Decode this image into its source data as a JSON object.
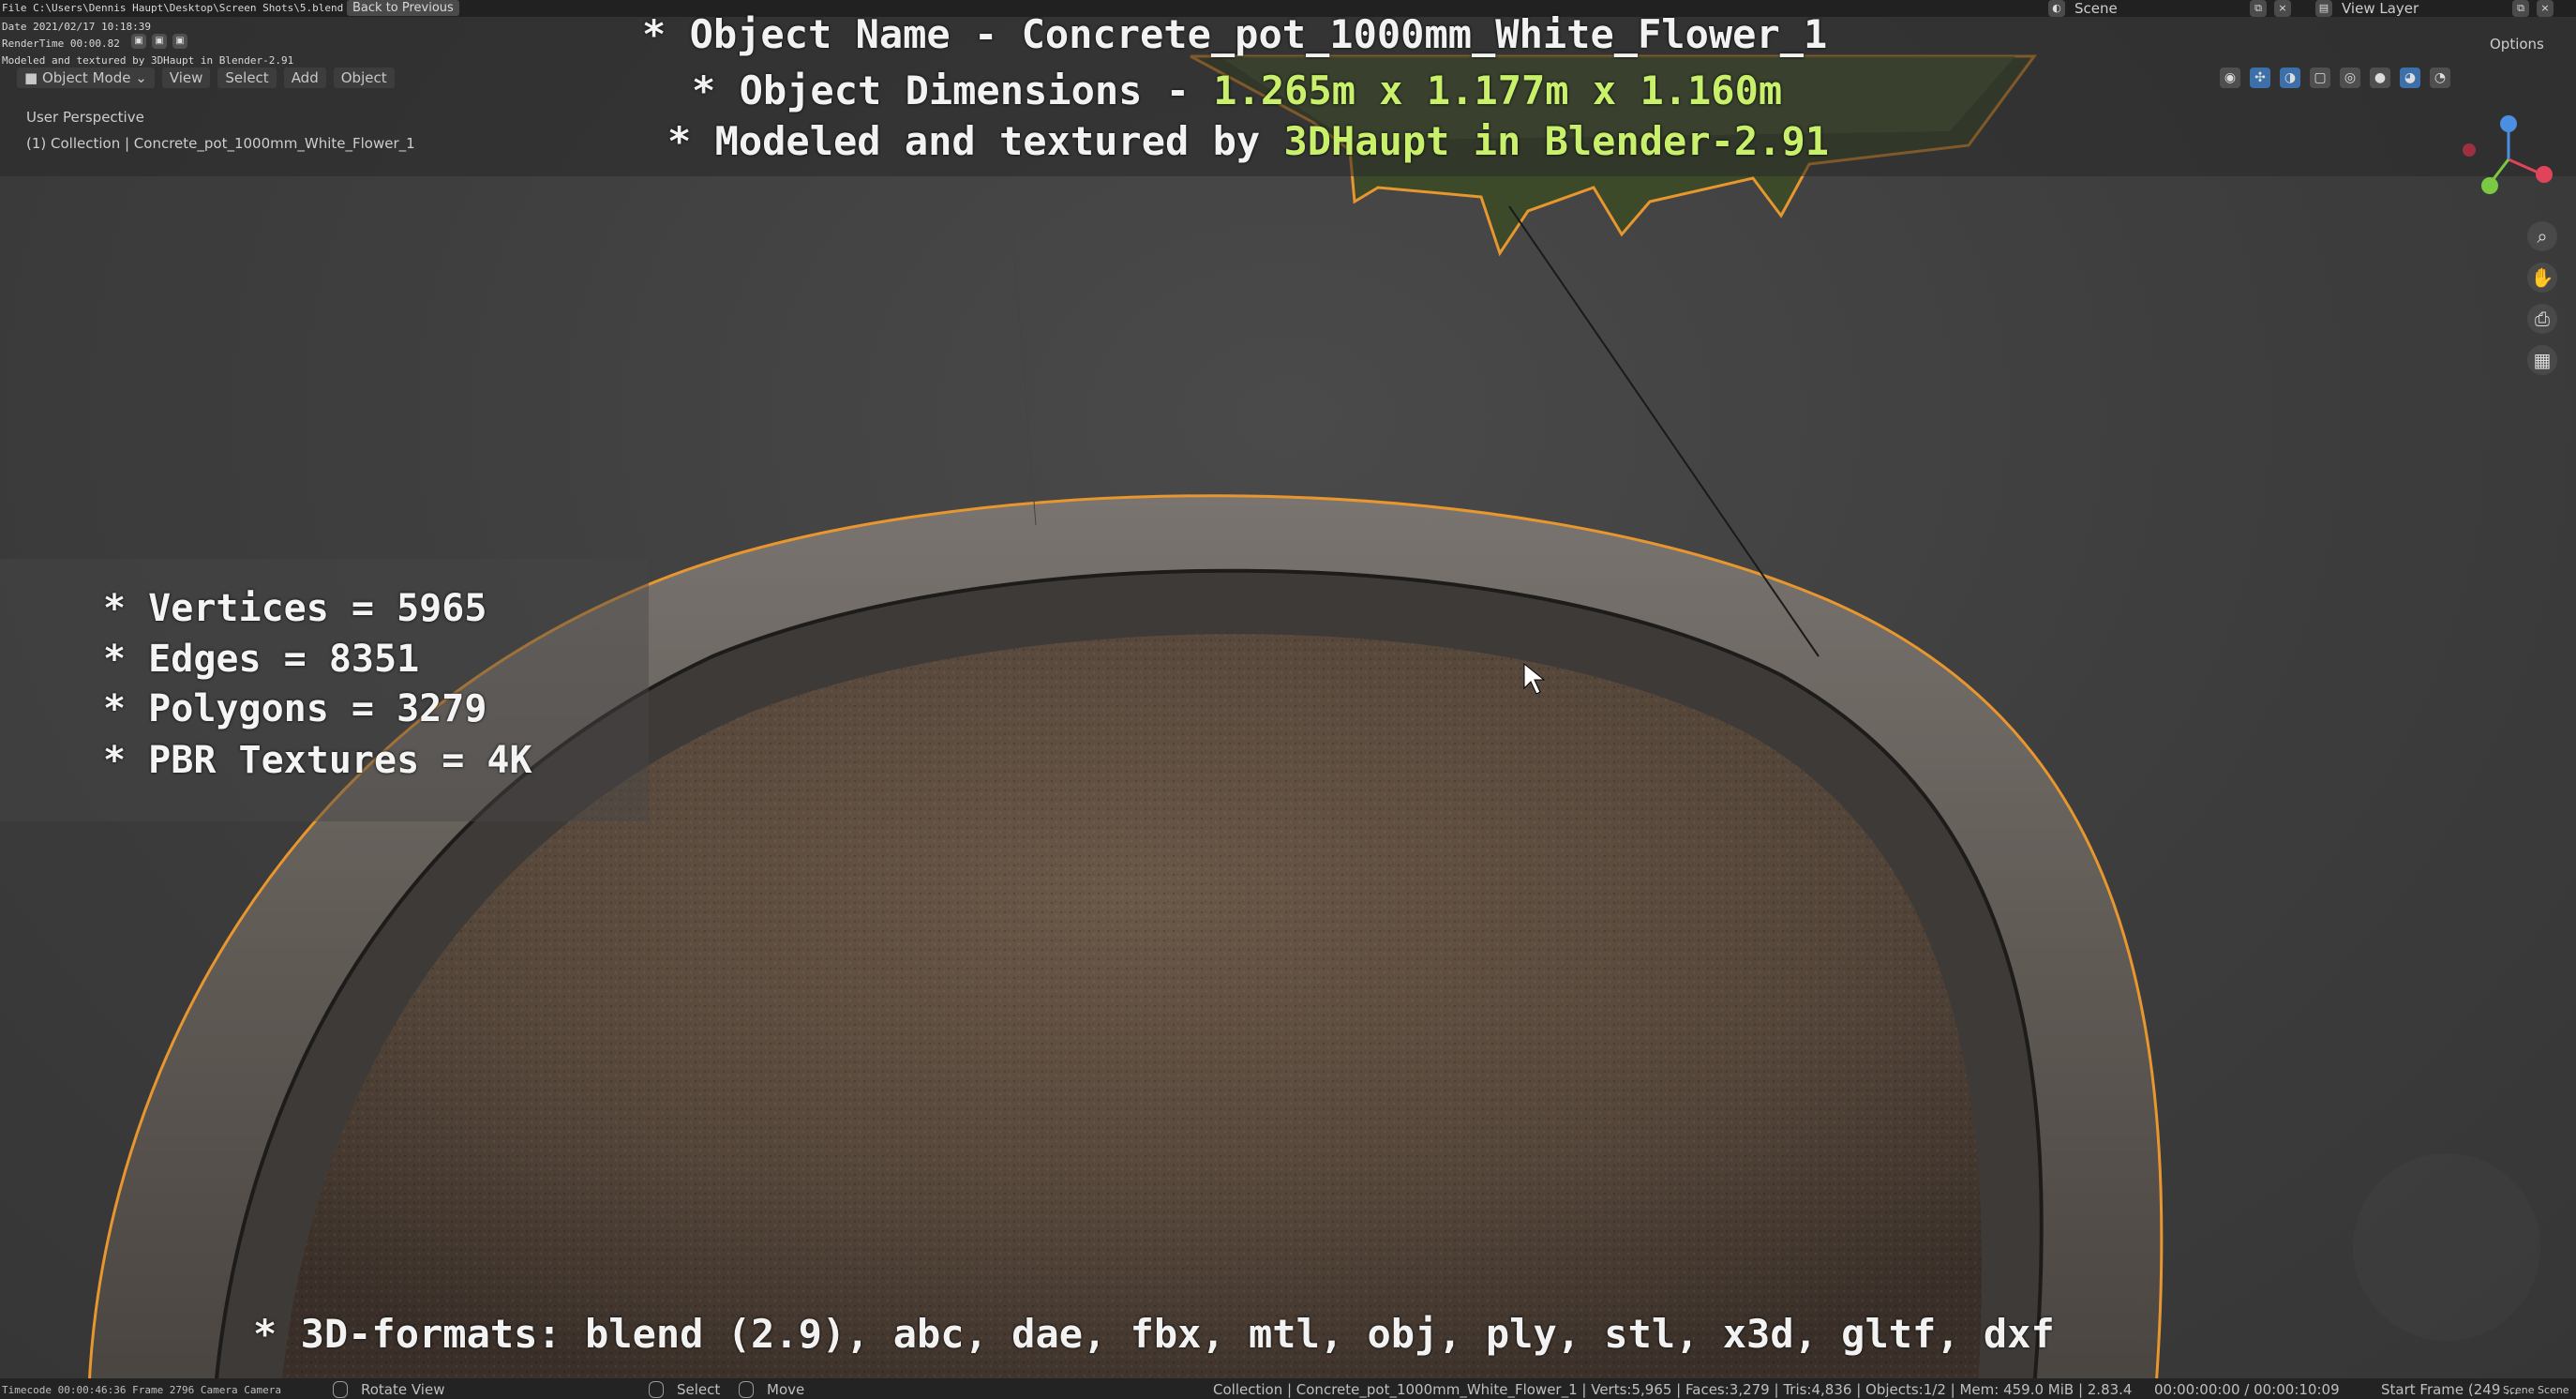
{
  "header": {
    "file_path": "File C:\\Users\\Dennis Haupt\\Desktop\\Screen Shots\\5.blend",
    "back_button": "Back to Previous",
    "date_line": "Date 2021/02/17 10:18:39",
    "render_time": "RenderTime 00:00.82",
    "credit_line": "Modeled and textured by 3DHaupt in Blender-2.91",
    "scene_label": "Scene",
    "view_layer_label": "View Layer",
    "options_label": "Options"
  },
  "viewport_header": {
    "mode": "Object Mode",
    "menus": [
      "View",
      "Select",
      "Add",
      "Object"
    ]
  },
  "viewport_info": {
    "perspective": "User Perspective",
    "collection": "(1) Collection | Concrete_pot_1000mm_White_Flower_1"
  },
  "overlay": {
    "line1": "* Object Name - Concrete_pot_1000mm_White_Flower_1",
    "line2_prefix": "* Object Dimensions - ",
    "line2_value": "1.265m x 1.177m x 1.160m",
    "line3_prefix": "* Modeled and textured by ",
    "line3_value": "3DHaupt in Blender-2.91",
    "formats": "* 3D-formats: blend (2.9), abc, dae, fbx, mtl, obj, ply, stl, x3d, gltf, dxf"
  },
  "stats": [
    "* Vertices = 5965",
    "* Edges = 8351",
    "* Polygons = 3279",
    "* PBR Textures = 4K"
  ],
  "statusbar": {
    "timecode": "Timecode 00:00:46:36  Frame 2796  Camera Camera",
    "rotate_view": "Rotate View",
    "select": "Select",
    "move": "Move",
    "scene_stats": "Collection | Concrete_pot_1000mm_White_Flower_1 | Verts:5,965 | Faces:3,279 | Tris:4,836 | Objects:1/2 | Mem: 459.0 MiB | 2.83.4",
    "time": "00:00:00:00 / 00:00:10:09",
    "start_frame": "Start Frame (249 ...",
    "scene_right": "Scene  Scene"
  },
  "colors": {
    "selection_outline": "#e8962e",
    "caption_highlight": "#c9f06a",
    "soil": "#5a4a3e",
    "concrete": "#6e6863"
  },
  "icons": [
    "zoom-icon",
    "hand-pan-icon",
    "camera-icon",
    "grid-icon",
    "axis-gizmo-icon",
    "cursor-icon"
  ]
}
